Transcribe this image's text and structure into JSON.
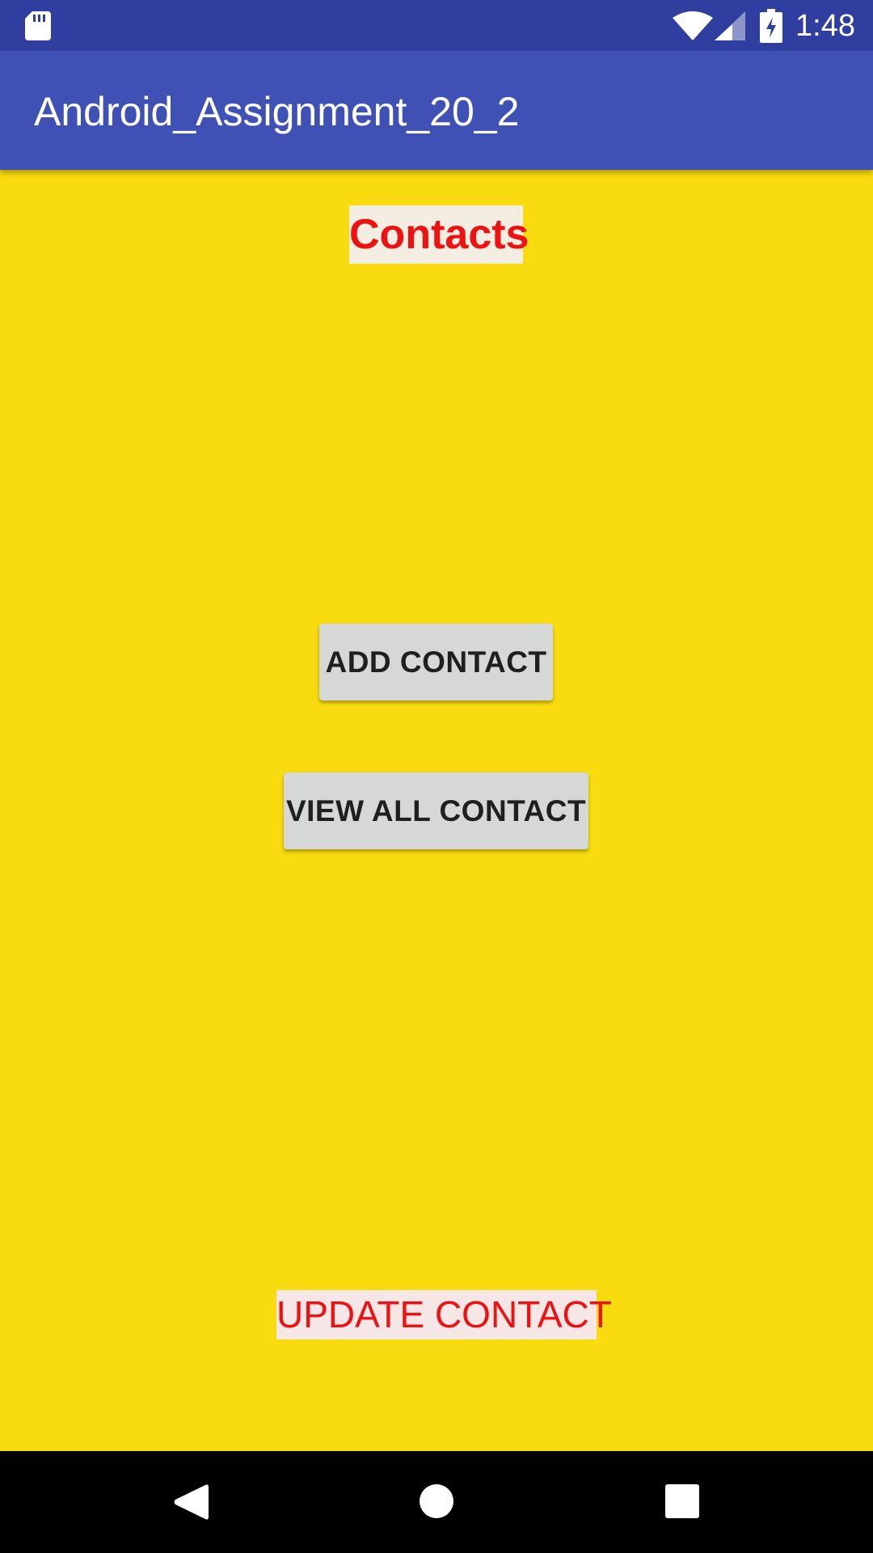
{
  "status_bar": {
    "time": "1:48",
    "icons": [
      "sd-card-icon",
      "wifi-icon",
      "signal-icon",
      "battery-charging-icon"
    ]
  },
  "app_bar": {
    "title": "Android_Assignment_20_2",
    "color": "#3f51b5"
  },
  "main": {
    "background_color": "#f8dc0f",
    "heading": "Contacts",
    "add_button_label": "ADD CONTACT",
    "view_all_button_label": "VIEW ALL CONTACT",
    "update_label": "UPDATE CONTACT",
    "accent_text_color": "#ee1111"
  },
  "nav_bar": {
    "icons": [
      "back-icon",
      "home-icon",
      "recents-icon"
    ]
  }
}
